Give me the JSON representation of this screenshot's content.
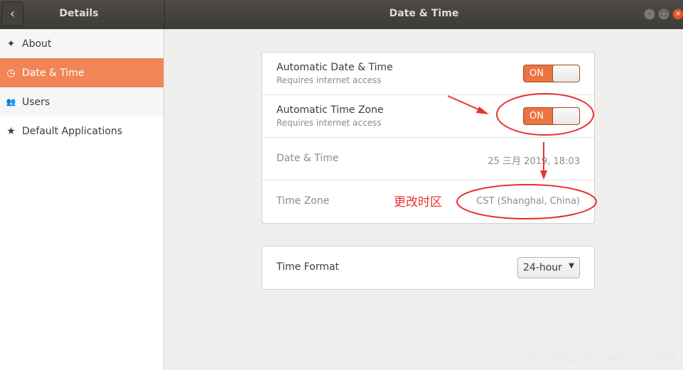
{
  "titlebar": {
    "left_title": "Details",
    "main_title": "Date & Time",
    "back_icon": "chevron-left-icon"
  },
  "sidebar": {
    "items": [
      {
        "label": "About",
        "icon": "sparkle-icon"
      },
      {
        "label": "Date & Time",
        "icon": "clock-icon",
        "active": true
      },
      {
        "label": "Users",
        "icon": "users-icon"
      },
      {
        "label": "Default Applications",
        "icon": "star-icon"
      }
    ]
  },
  "settings": {
    "auto_datetime": {
      "label": "Automatic Date & Time",
      "sub": "Requires internet access",
      "state": "ON"
    },
    "auto_timezone": {
      "label": "Automatic Time Zone",
      "sub": "Requires internet access",
      "state": "ON"
    },
    "datetime": {
      "label": "Date & Time",
      "value": "25 三月 2019, 18:03"
    },
    "timezone": {
      "label": "Time Zone",
      "value": "CST (Shanghai, China)"
    },
    "time_format": {
      "label": "Time Format",
      "value": "24-hour"
    }
  },
  "annotation": {
    "text": "更改时区",
    "color": "#e8322f"
  },
  "watermark": "https://blog.csdn.net/cc007cc009",
  "colors": {
    "accent": "#f18556",
    "switch": "#ec7440"
  }
}
